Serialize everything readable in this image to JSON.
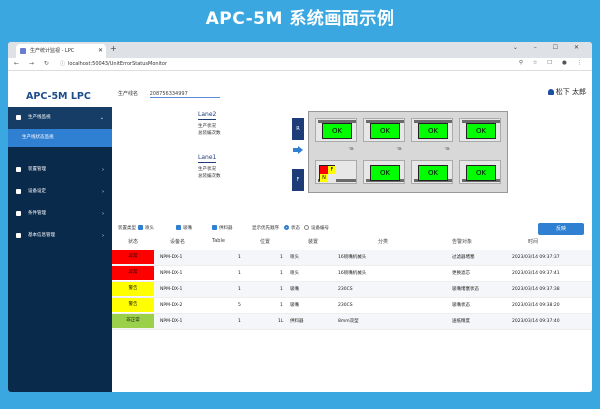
{
  "banner": {
    "title": "APC-5M 系统画面示例"
  },
  "browser": {
    "tab_title": "生产统计监视 - LPC",
    "url": "localhost:50043/UnitErrorStatusMonitor"
  },
  "app": {
    "brand": "APC-5M LPC",
    "line_label": "生产线名",
    "line_value": "208756334997",
    "user": "松下 太郎"
  },
  "sidebar": {
    "items": [
      {
        "label": "生产线监视"
      },
      {
        "label": "装置管理"
      },
      {
        "label": "设备设定"
      },
      {
        "label": "条件管理"
      },
      {
        "label": "基本信息管理"
      }
    ],
    "sub_item": "生产线状态监视"
  },
  "lanes": [
    {
      "title": "Lane2",
      "line1": "生产状况",
      "line2": "总装编次数"
    },
    {
      "title": "Lane1",
      "line1": "生产状况",
      "line2": "总装编次数"
    }
  ],
  "side_labels": {
    "rear": "R",
    "front": "F"
  },
  "machine": {
    "ok_label": "OK",
    "error_letters": [
      "F",
      "N"
    ],
    "tray_label": "TB"
  },
  "filters": {
    "type_label": "装置类型",
    "opt1": "喷头",
    "opt2": "吸嘴",
    "opt3": "供料器",
    "sort_label": "显示优先顺序",
    "radio1": "状态",
    "radio2": "设备编号",
    "reset_button": "反映"
  },
  "table": {
    "headers": [
      "状态",
      "设备名",
      "Table",
      "位置",
      "装置",
      "分类",
      "告警对象",
      "时间"
    ],
    "rows": [
      {
        "status": "异常",
        "color": "#ff0000",
        "device": "NPM-DX-1",
        "table": "1",
        "pos": "1",
        "unit": "喷头",
        "category": "16喷嘴机械头",
        "target": "过滤器堵塞",
        "time": "2023/03/14 09:37:37"
      },
      {
        "status": "异常",
        "color": "#ff0000",
        "device": "NPM-DX-1",
        "table": "1",
        "pos": "1",
        "unit": "喷头",
        "category": "16喷嘴机械头",
        "target": "更换滤芯",
        "time": "2023/03/14 09:37:41"
      },
      {
        "status": "警告",
        "color": "#ffff00",
        "device": "NPM-DX-1",
        "table": "1",
        "pos": "1",
        "unit": "吸嘴",
        "category": "230CS",
        "target": "吸嘴堵塞状态",
        "time": "2023/03/14 09:37:38"
      },
      {
        "status": "警告",
        "color": "#ffff00",
        "device": "NPM-DX-2",
        "table": "5",
        "pos": "1",
        "unit": "吸嘴",
        "category": "230CS",
        "target": "吸嘴状态",
        "time": "2023/03/14 09:38:20"
      },
      {
        "status": "非正常",
        "color": "#9bd14a",
        "device": "NPM-DX-1",
        "table": "1",
        "pos": "1L",
        "unit": "供料器",
        "category": "8mm双型",
        "target": "送纸精度",
        "time": "2023/03/14 09:37:40"
      }
    ]
  },
  "colors": {
    "ok": "#00ff00",
    "primary": "#2f7fd3",
    "sidebar": "#0a2a4c"
  }
}
